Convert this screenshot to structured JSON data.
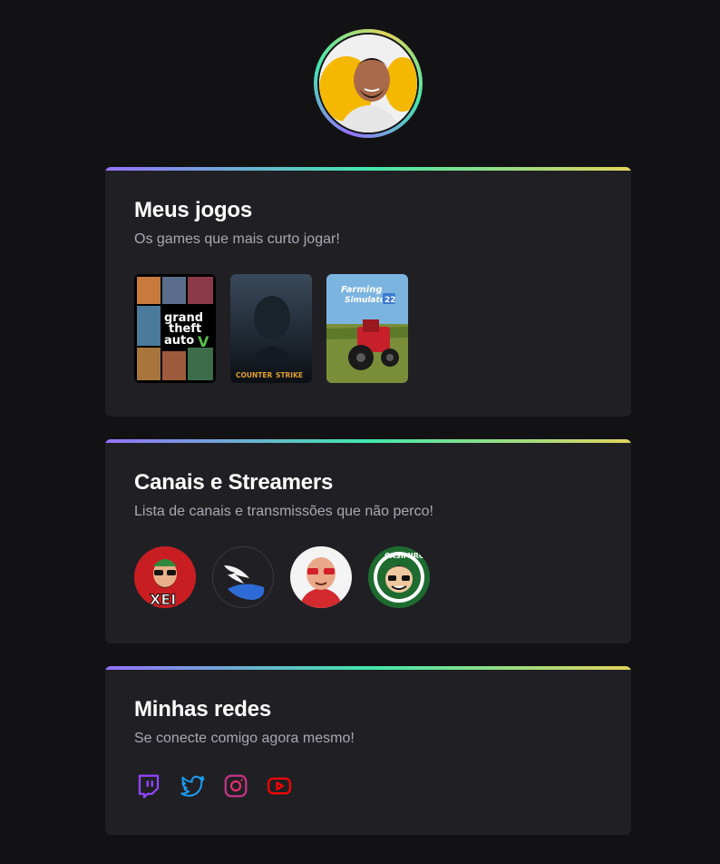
{
  "profile": {
    "avatar": "profile-photo"
  },
  "games_section": {
    "title": "Meus jogos",
    "subtitle": "Os games que mais curto jogar!",
    "games": [
      {
        "name": "gta-v-cover"
      },
      {
        "name": "counter-strike-cover"
      },
      {
        "name": "farming-simulator-22-cover"
      }
    ]
  },
  "channels_section": {
    "title": "Canais e Streamers",
    "subtitle": "Lista de canais e transmissões que não perco!",
    "channels": [
      {
        "name": "xei-channel-avatar"
      },
      {
        "name": "wings-channel-avatar"
      },
      {
        "name": "streamer-red-glasses-avatar"
      },
      {
        "name": "casimiro-channel-avatar"
      }
    ]
  },
  "social_section": {
    "title": "Minhas redes",
    "subtitle": "Se conecte comigo agora mesmo!",
    "links": [
      {
        "icon": "twitch-icon",
        "color": "#9146ff"
      },
      {
        "icon": "twitter-icon",
        "color": "#1d9bf0"
      },
      {
        "icon": "instagram-icon",
        "color": "#e1306c"
      },
      {
        "icon": "youtube-icon",
        "color": "#ff0000"
      }
    ]
  },
  "colors": {
    "background": "#121214",
    "card": "#202024",
    "gradient": [
      "#9572fc",
      "#43e7ad",
      "#e2d45c"
    ]
  }
}
